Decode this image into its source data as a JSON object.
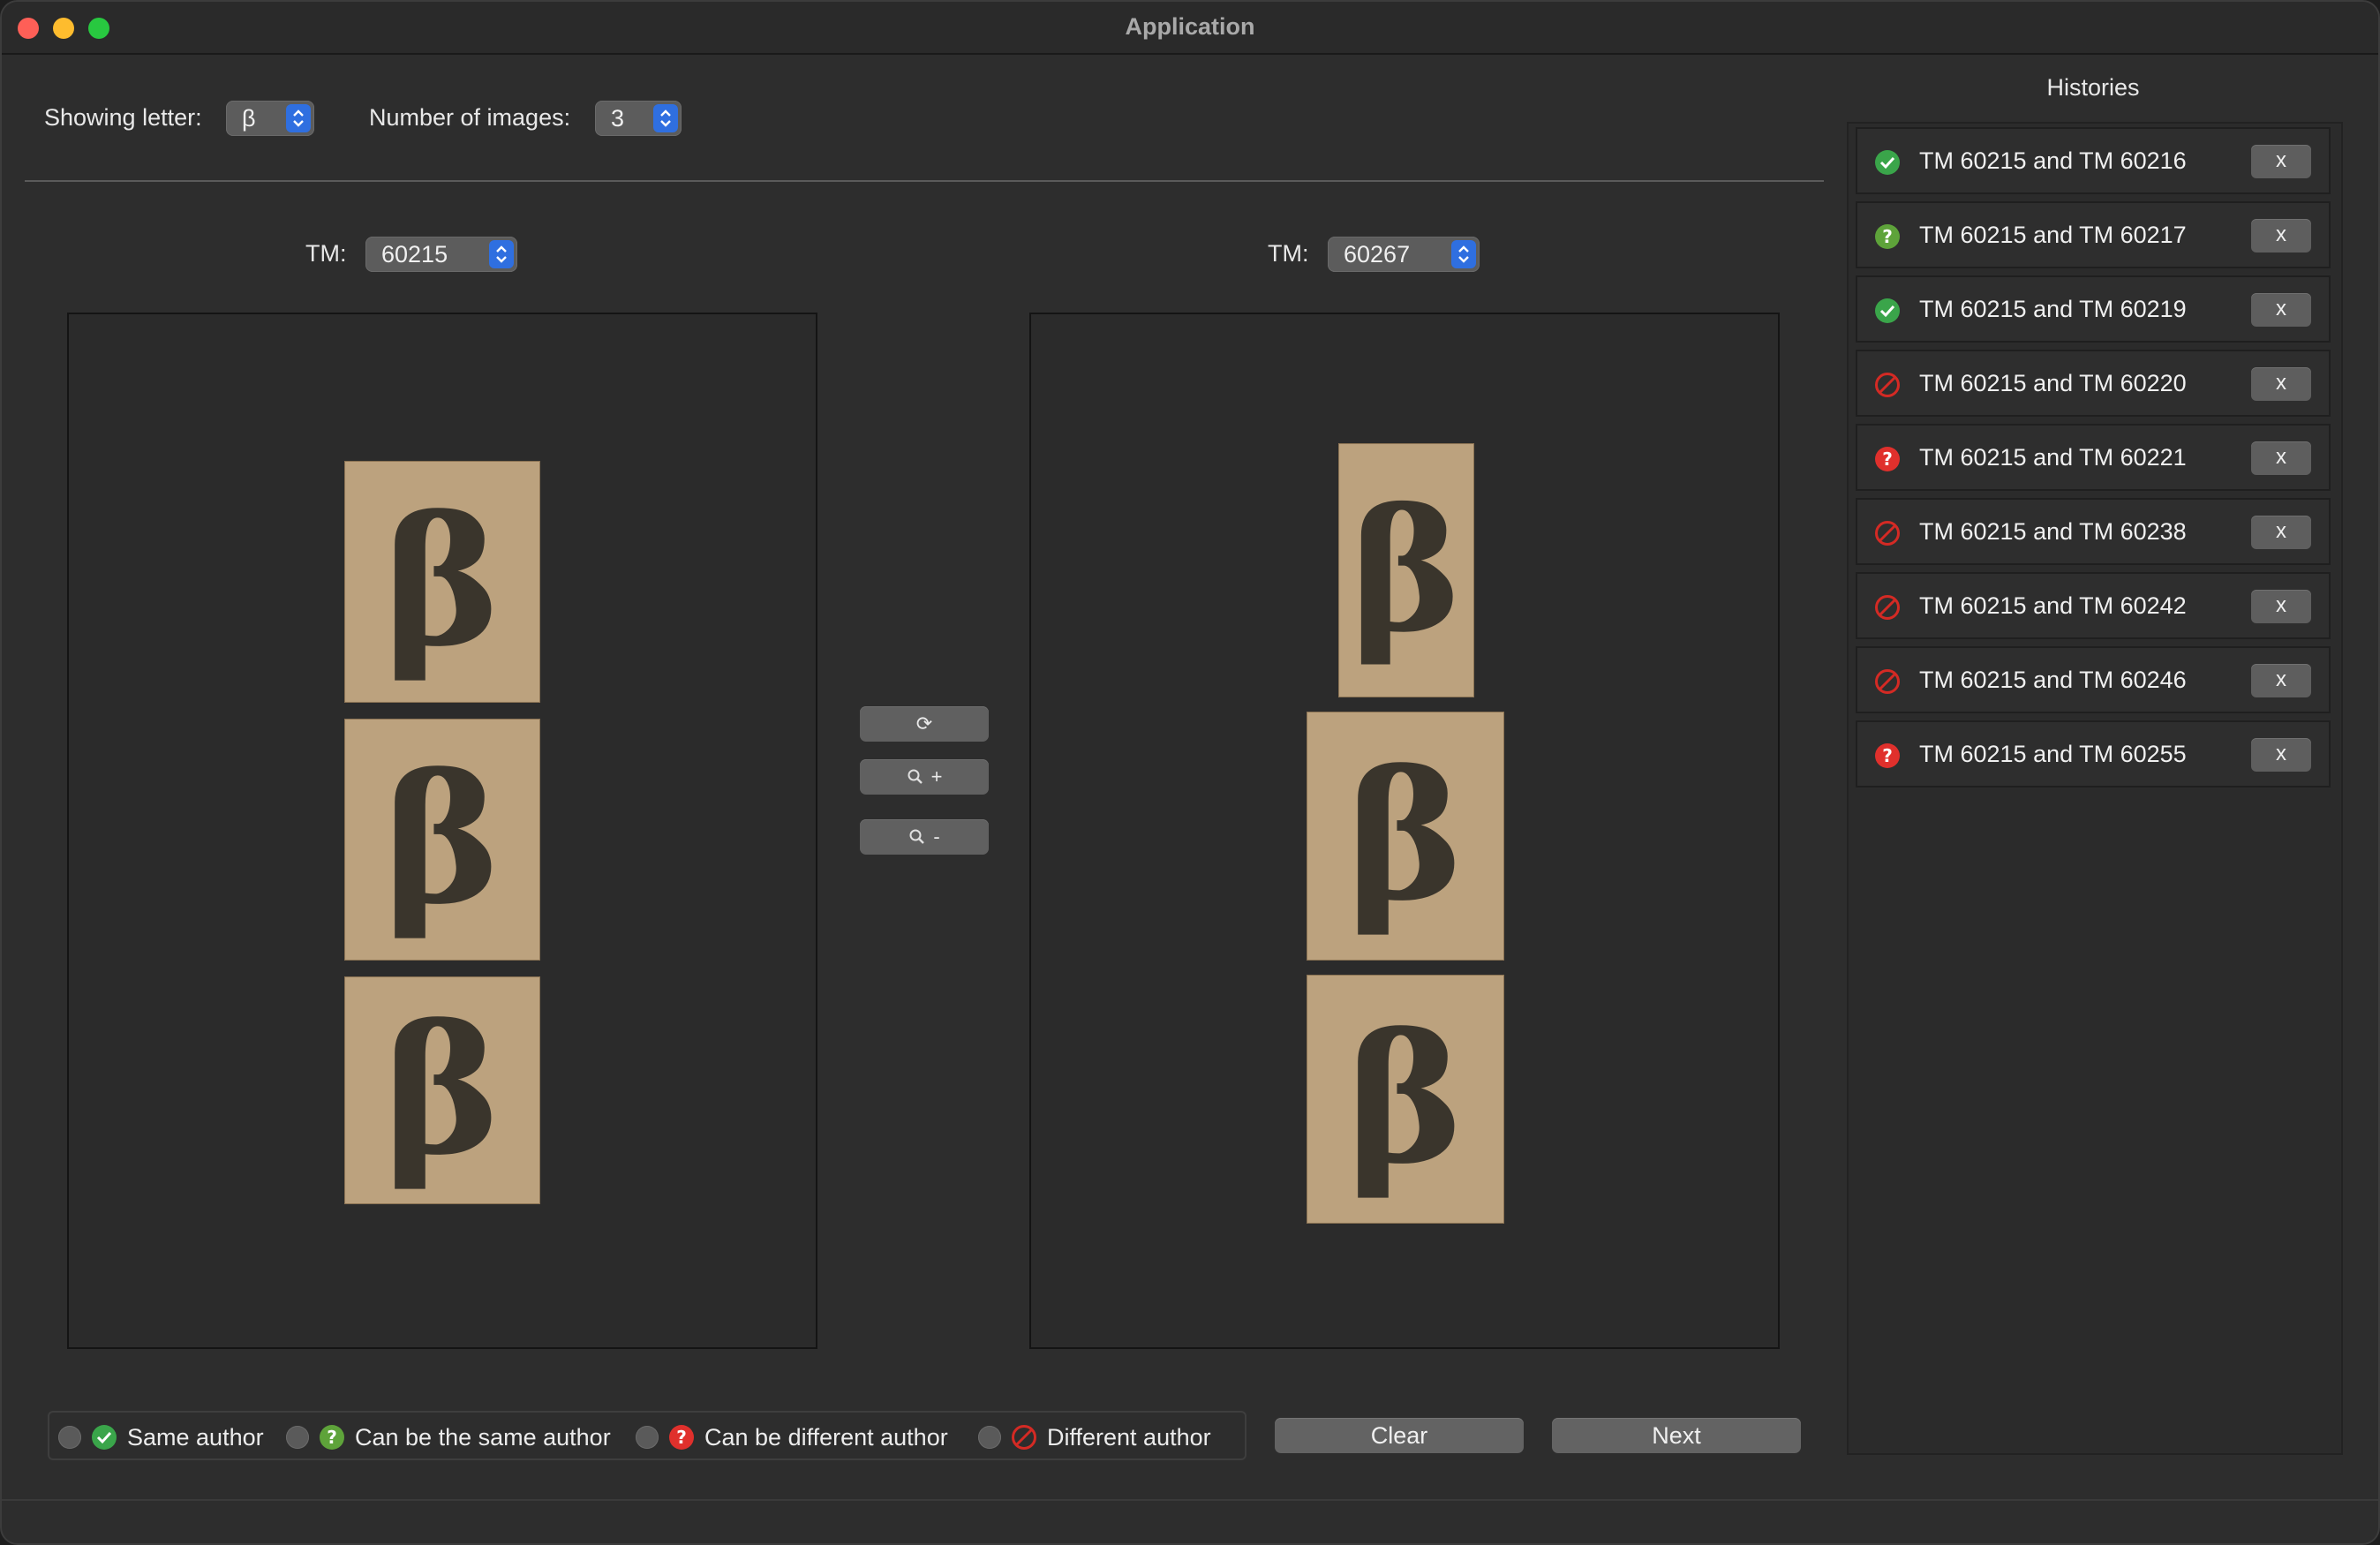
{
  "window": {
    "title": "Application"
  },
  "toolbar": {
    "letter_label": "Showing letter:",
    "letter_value": "β",
    "images_label": "Number of images:",
    "images_value": "3"
  },
  "left": {
    "tm_label": "TM:",
    "tm_value": "60215",
    "glyph_char": "β"
  },
  "right": {
    "tm_label": "TM:",
    "tm_value": "60267",
    "glyph_char": "β"
  },
  "controls": {
    "reset": "⟳",
    "zoom_in": "+",
    "zoom_out": "-"
  },
  "histories": {
    "title": "Histories",
    "remove_label": "x",
    "items": [
      {
        "label": "TM 60215 and TM 60216",
        "status": "same-author"
      },
      {
        "label": "TM 60215 and TM 60217",
        "status": "can-be-same"
      },
      {
        "label": "TM 60215 and TM 60219",
        "status": "same-author"
      },
      {
        "label": "TM 60215 and TM 60220",
        "status": "different"
      },
      {
        "label": "TM 60215 and TM 60221",
        "status": "can-be-different"
      },
      {
        "label": "TM 60215 and TM 60238",
        "status": "different"
      },
      {
        "label": "TM 60215 and TM 60242",
        "status": "different"
      },
      {
        "label": "TM 60215 and TM 60246",
        "status": "different"
      },
      {
        "label": "TM 60215 and TM 60255",
        "status": "can-be-different"
      }
    ]
  },
  "options": {
    "same_author": "Same author",
    "can_be_same": "Can be the same author",
    "can_be_different": "Can be different author",
    "different": "Different author"
  },
  "buttons": {
    "clear": "Clear",
    "next": "Next"
  },
  "colors": {
    "accent": "#2f6fe0",
    "same": "#3aa54a",
    "maybe_same": "#5ea33a",
    "maybe_diff": "#e0302c",
    "diff": "#d42a24"
  }
}
